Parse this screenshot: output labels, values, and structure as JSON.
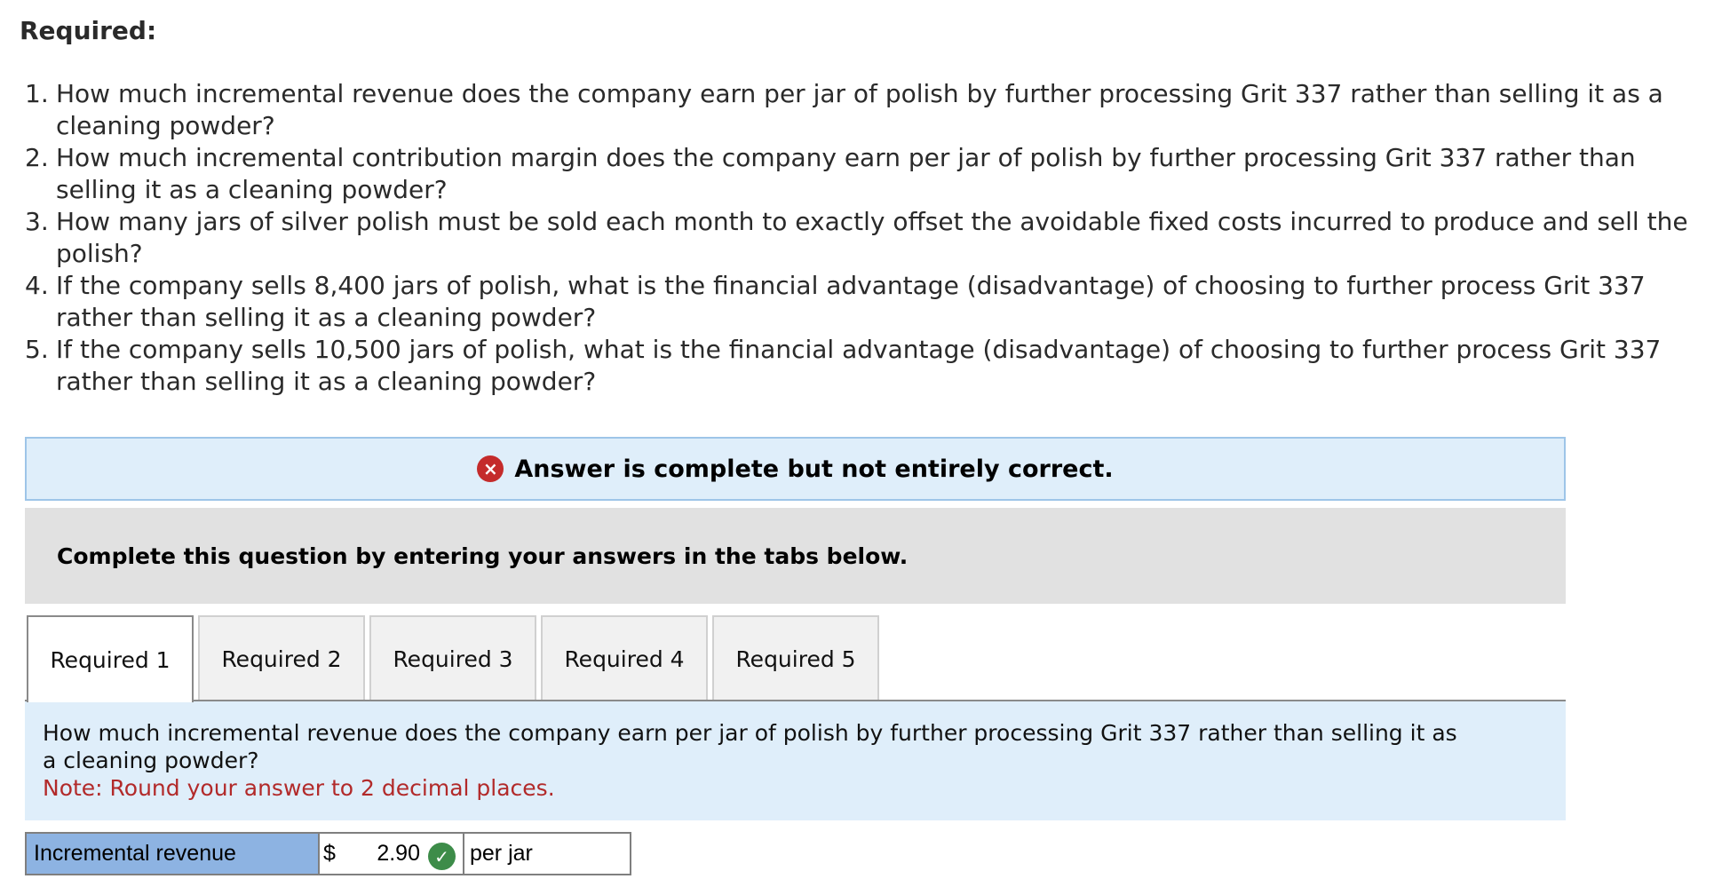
{
  "heading": "Required:",
  "questions": [
    {
      "num": "1.",
      "lines": [
        "How much incremental revenue does the company earn per jar of polish by further processing Grit 337 rather than selling it as a",
        "cleaning powder?"
      ]
    },
    {
      "num": "2.",
      "lines": [
        "How much incremental contribution margin does the company earn per jar of polish by further processing Grit 337 rather than",
        "selling it as a cleaning powder?"
      ]
    },
    {
      "num": "3.",
      "lines": [
        "How many jars of silver polish must be sold each month to exactly offset the avoidable fixed costs incurred to produce and sell the",
        "polish?"
      ]
    },
    {
      "num": "4.",
      "lines": [
        "If the company sells 8,400 jars of polish, what is the financial advantage (disadvantage) of choosing to further process Grit 337",
        "rather than selling it as a cleaning powder?"
      ]
    },
    {
      "num": "5.",
      "lines": [
        "If the company sells 10,500 jars of polish, what is the financial advantage (disadvantage) of choosing to further process Grit 337",
        "rather than selling it as a cleaning powder?"
      ]
    }
  ],
  "banner": {
    "icon": "x-circle-icon",
    "icon_glyph": "×",
    "text": "Answer is complete but not entirely correct."
  },
  "instructions": "Complete this question by entering your answers in the tabs below.",
  "tabs": [
    "Required 1",
    "Required 2",
    "Required 3",
    "Required 4",
    "Required 5"
  ],
  "active_tab": "Required 1",
  "panel": {
    "question_lines": [
      "How much incremental revenue does the company earn per jar of polish by further processing Grit 337 rather than selling it as",
      "a cleaning powder?"
    ],
    "note": "Note: Round your answer to 2 decimal places."
  },
  "answer": {
    "label": "Incremental revenue",
    "currency": "$",
    "value": "2.90",
    "status_icon": "check-circle-icon",
    "check_glyph": "✓",
    "unit": "per jar"
  },
  "colors": {
    "error": "#c42b2b",
    "correct": "#3d8c49",
    "banner_bg": "#dfeefa",
    "label_bg": "#8db3e2"
  }
}
